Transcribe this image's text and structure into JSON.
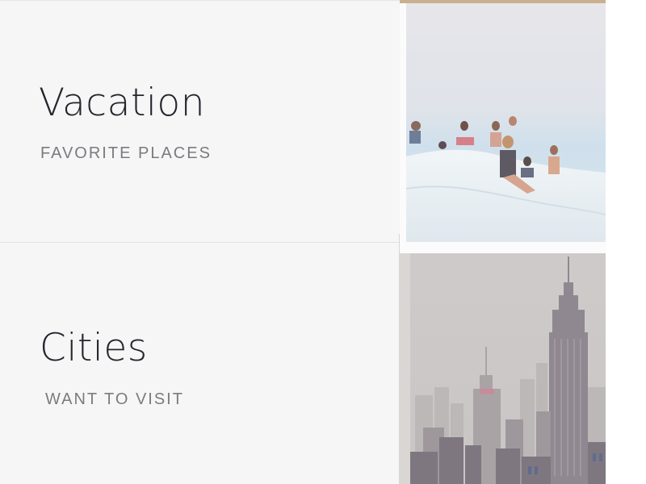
{
  "cards": [
    {
      "title": "Vacation",
      "subtitle": "FAVORITE PLACES",
      "image": "people-on-rocks-photo"
    },
    {
      "title": "Cities",
      "subtitle": "WANT TO VISIT",
      "image": "city-skyline-photo"
    }
  ],
  "colors": {
    "card_background": "#f6f6f6",
    "title": "#25252d",
    "subtitle": "#7b7b80",
    "divider": "#e2e2e2"
  }
}
